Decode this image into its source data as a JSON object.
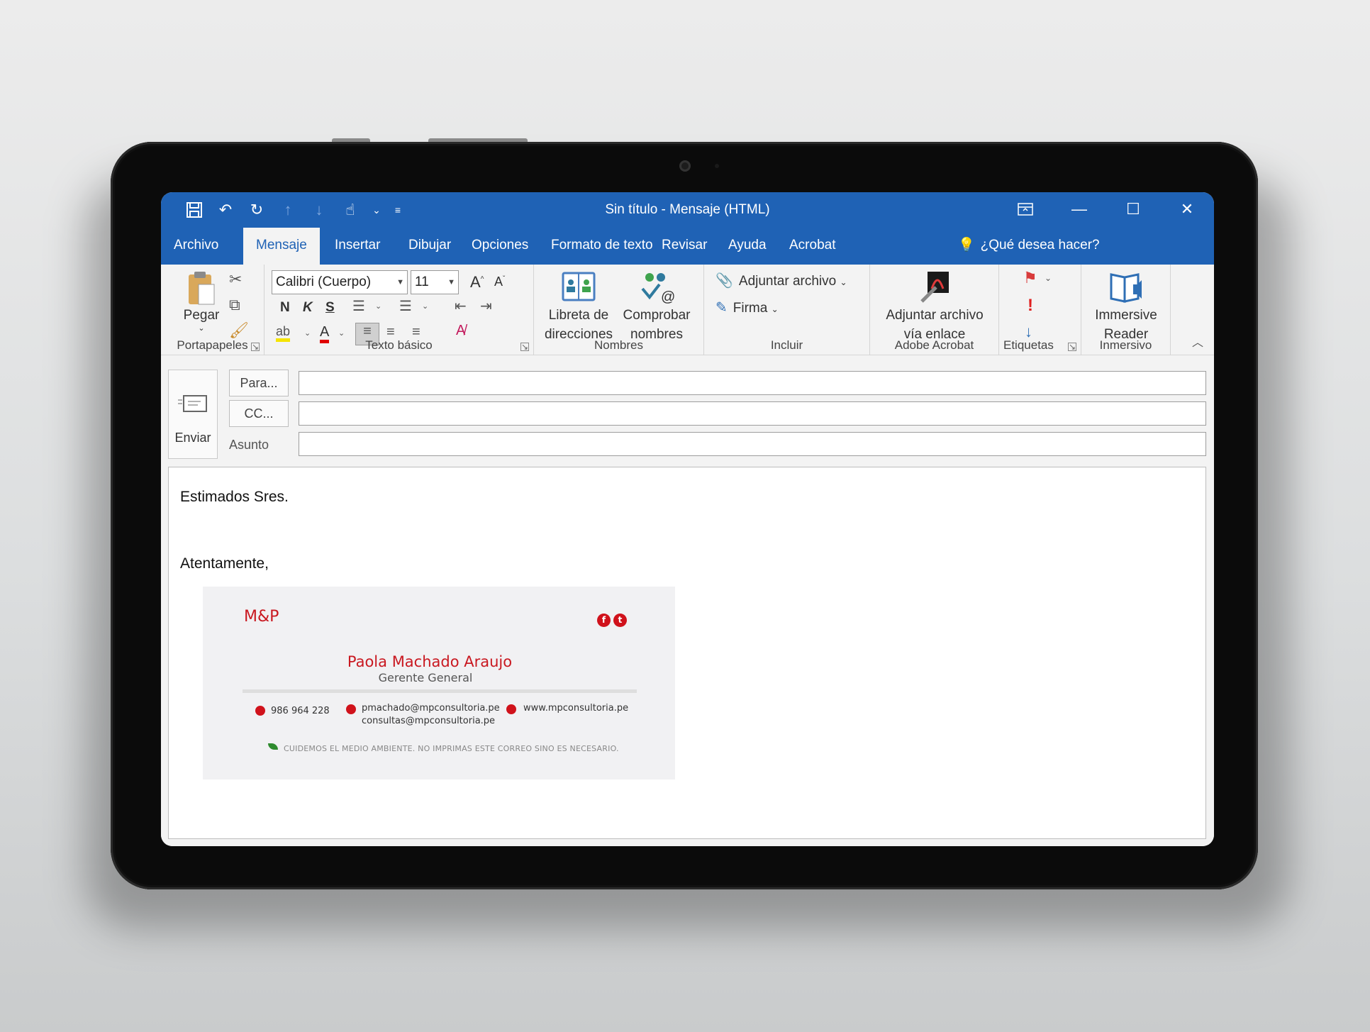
{
  "window": {
    "title": "Sin título  -  Mensaje (HTML)"
  },
  "tabs": [
    "Archivo",
    "Mensaje",
    "Insertar",
    "Dibujar",
    "Opciones",
    "Formato de texto",
    "Revisar",
    "Ayuda",
    "Acrobat"
  ],
  "tell_me": "¿Qué desea hacer?",
  "ribbon": {
    "clipboard": {
      "paste": "Pegar",
      "group": "Portapapeles"
    },
    "basic_text": {
      "font": "Calibri (Cuerpo)",
      "size": "11",
      "bold": "N",
      "italic": "K",
      "underline": "S",
      "group": "Texto básico"
    },
    "names": {
      "address_book_1": "Libreta de",
      "address_book_2": "direcciones",
      "check_names_1": "Comprobar",
      "check_names_2": "nombres",
      "group": "Nombres"
    },
    "include": {
      "attach": "Adjuntar archivo",
      "signature": "Firma",
      "group": "Incluir"
    },
    "acrobat": {
      "line1": "Adjuntar archivo",
      "line2": "vía enlace",
      "group": "Adobe Acrobat"
    },
    "tags": {
      "group": "Etiquetas"
    },
    "immersive": {
      "line1": "Immersive",
      "line2": "Reader",
      "group": "Inmersivo"
    }
  },
  "compose": {
    "send": "Enviar",
    "to": "Para...",
    "cc": "CC...",
    "subject": "Asunto",
    "to_value": "",
    "cc_value": "",
    "subject_value": ""
  },
  "body": {
    "greeting": "Estimados Sres.",
    "closing": "Atentamente,"
  },
  "signature": {
    "logo": "M&P",
    "name": "Paola Machado Araujo",
    "role": "Gerente General",
    "phone": "986 964 228",
    "email1": "pmachado@mpconsultoria.pe",
    "email2": "consultas@mpconsultoria.pe",
    "web": "www.mpconsultoria.pe",
    "note": "CUIDEMOS EL MEDIO AMBIENTE. NO IMPRIMAS ESTE CORREO SINO ES NECESARIO.",
    "brand_color": "#c91820"
  },
  "colors": {
    "titlebar": "#1f62b5",
    "ribbon": "#f3f3f3"
  }
}
